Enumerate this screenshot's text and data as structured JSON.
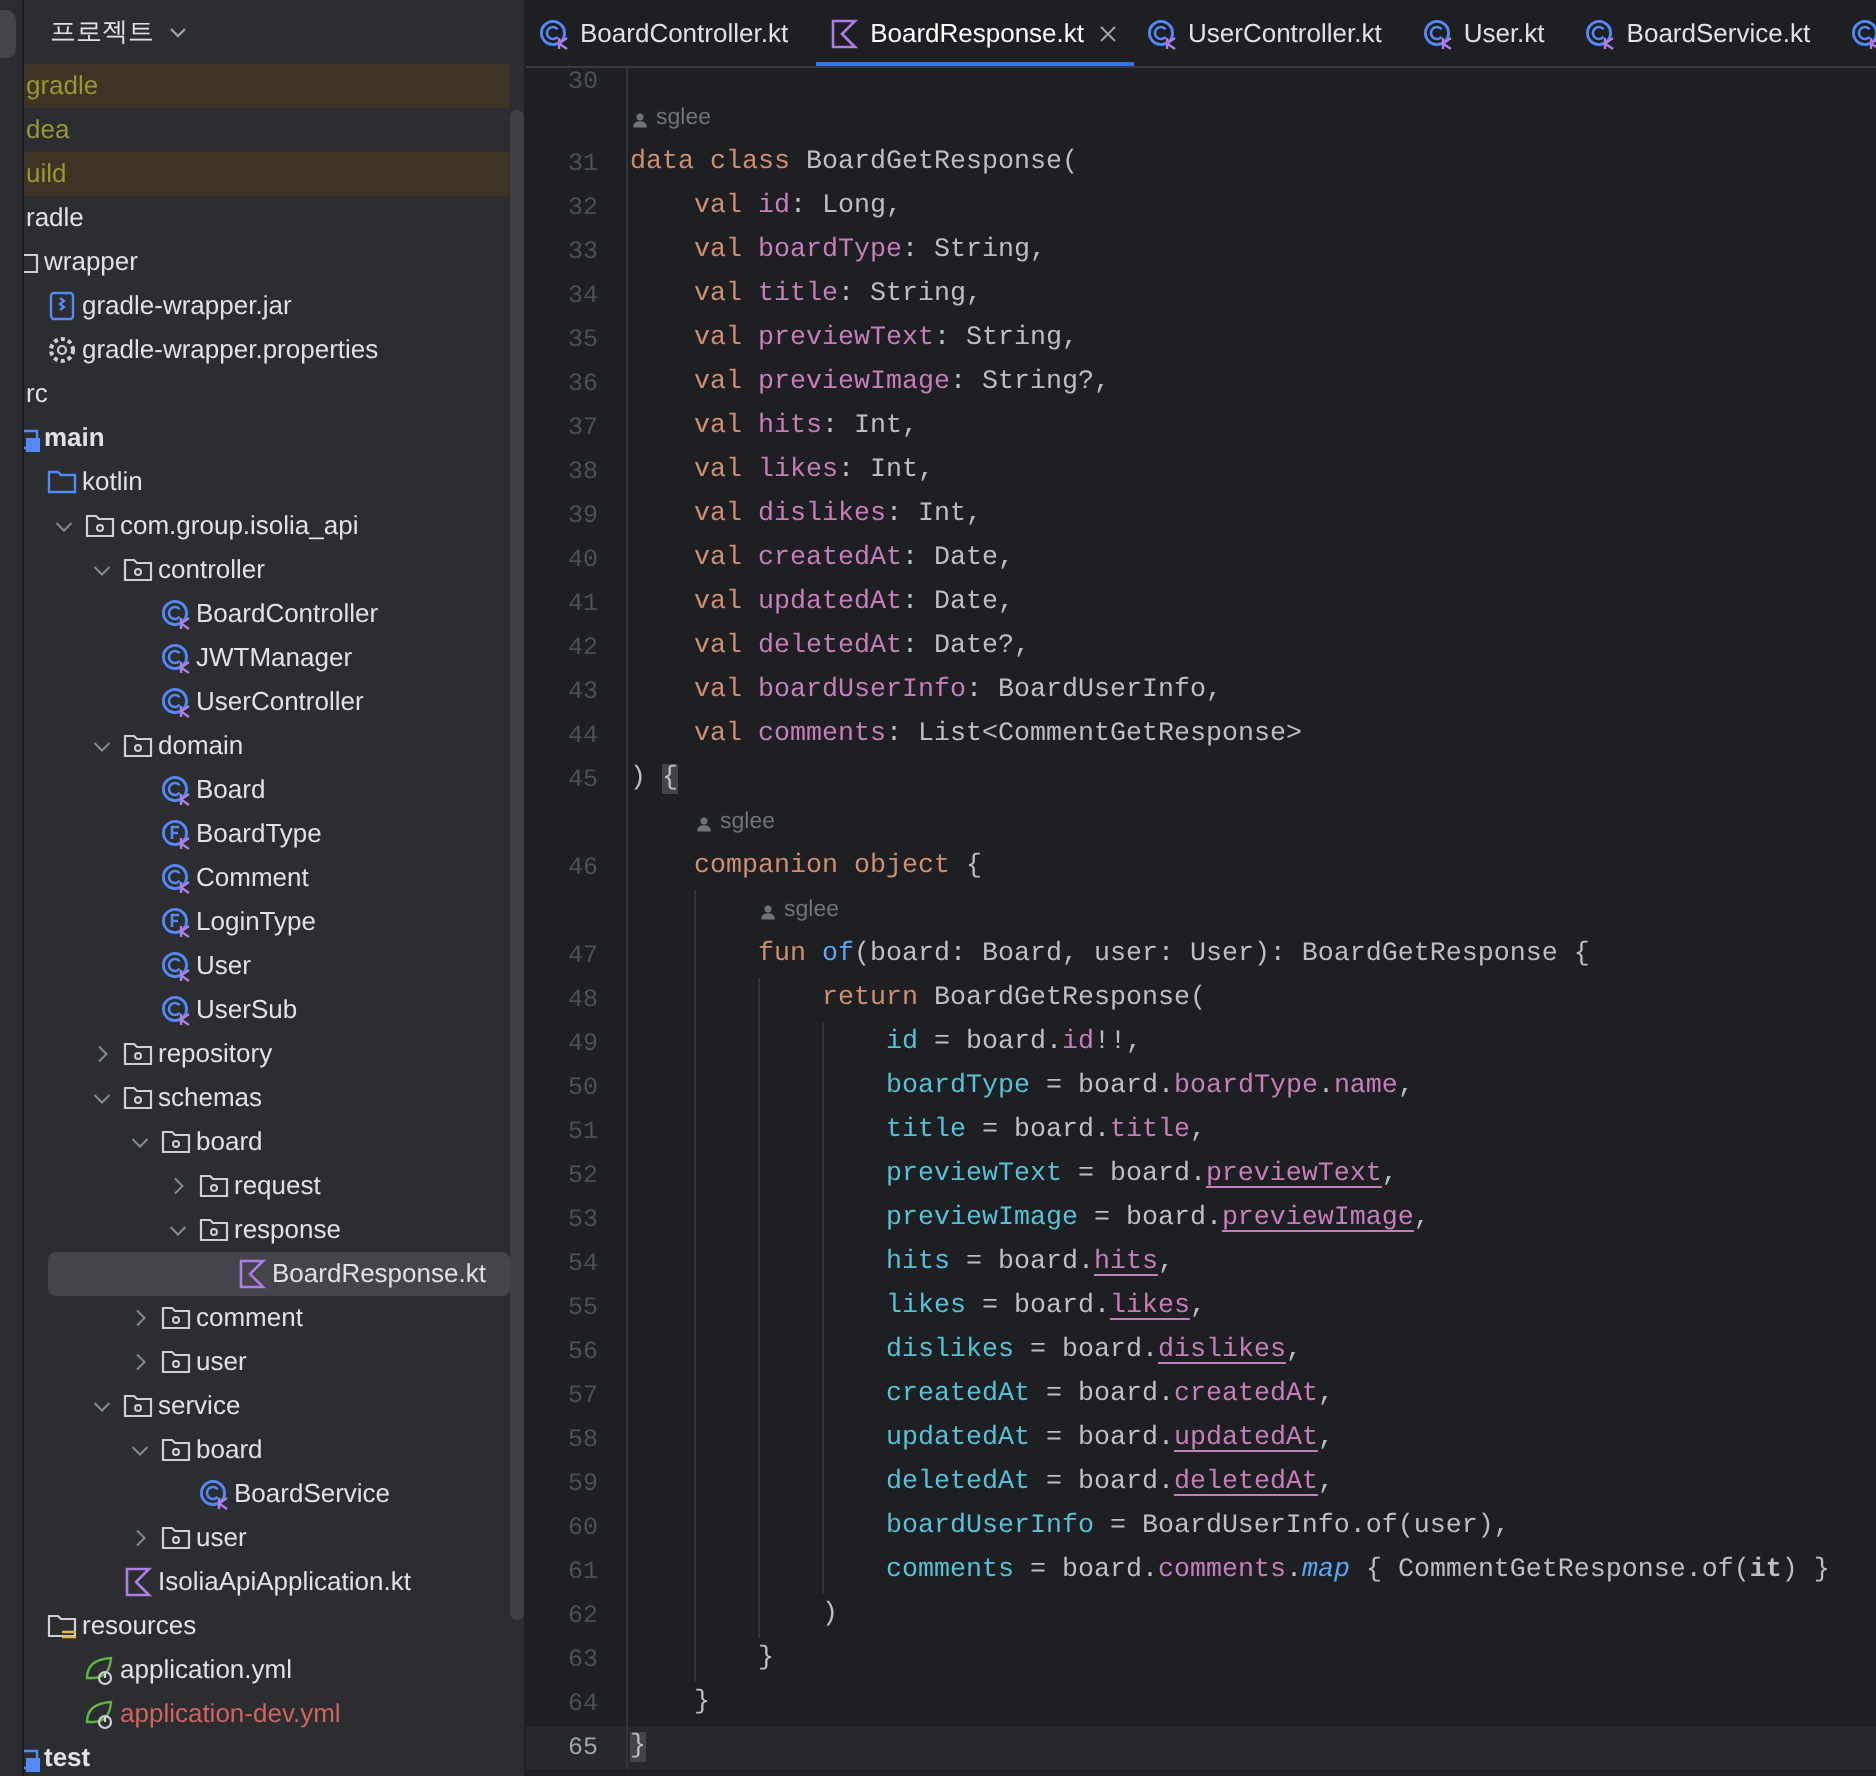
{
  "project_panel": {
    "title": "프로젝트",
    "tree": [
      {
        "label": "gradle",
        "ignored": true,
        "excluded": true,
        "unversioned": false,
        "selected": false
      },
      {
        "label": "dea",
        "ignored": true,
        "excluded": false,
        "unversioned": false,
        "selected": false
      },
      {
        "label": "uild",
        "ignored": true,
        "excluded": true,
        "unversioned": false,
        "selected": false
      },
      {
        "label": "radle",
        "ignored": false,
        "excluded": false,
        "unversioned": false,
        "selected": false,
        "children": [
          {
            "label": "wrapper",
            "kind": "folder",
            "ignored": false,
            "excluded": false,
            "unversioned": false,
            "selected": false,
            "children": [
              {
                "label": "gradle-wrapper.jar",
                "kind": "jar",
                "ignored": false,
                "excluded": false,
                "unversioned": false,
                "selected": false
              },
              {
                "label": "gradle-wrapper.properties",
                "kind": "properties",
                "ignored": false,
                "excluded": false,
                "unversioned": false,
                "selected": false
              }
            ]
          }
        ]
      },
      {
        "label": "rc",
        "ignored": false,
        "excluded": false,
        "unversioned": false,
        "selected": false,
        "children": [
          {
            "label": "main",
            "kind": "module",
            "ignored": false,
            "excluded": false,
            "unversioned": false,
            "selected": false,
            "children": [
              {
                "label": "kotlin",
                "kind": "source_folder",
                "ignored": false,
                "excluded": false,
                "unversioned": false,
                "selected": false,
                "children": [
                  {
                    "label": "com.group.isolia_api",
                    "kind": "package",
                    "ignored": false,
                    "excluded": false,
                    "unversioned": false,
                    "selected": false,
                    "expanded": true,
                    "children": [
                      {
                        "label": "controller",
                        "kind": "package",
                        "ignored": false,
                        "excluded": false,
                        "unversioned": false,
                        "selected": false,
                        "expanded": true,
                        "children": [
                          {
                            "label": "BoardController",
                            "kind": "class",
                            "ignored": false,
                            "excluded": false,
                            "unversioned": false,
                            "selected": false
                          },
                          {
                            "label": "JWTManager",
                            "kind": "class",
                            "ignored": false,
                            "excluded": false,
                            "unversioned": false,
                            "selected": false
                          },
                          {
                            "label": "UserController",
                            "kind": "class",
                            "ignored": false,
                            "excluded": false,
                            "unversioned": false,
                            "selected": false
                          }
                        ]
                      },
                      {
                        "label": "domain",
                        "kind": "package",
                        "ignored": false,
                        "excluded": false,
                        "unversioned": false,
                        "selected": false,
                        "expanded": true,
                        "children": [
                          {
                            "label": "Board",
                            "kind": "class",
                            "ignored": false,
                            "excluded": false,
                            "unversioned": false,
                            "selected": false
                          },
                          {
                            "label": "BoardType",
                            "kind": "enum",
                            "ignored": false,
                            "excluded": false,
                            "unversioned": false,
                            "selected": false
                          },
                          {
                            "label": "Comment",
                            "kind": "class",
                            "ignored": false,
                            "excluded": false,
                            "unversioned": false,
                            "selected": false
                          },
                          {
                            "label": "LoginType",
                            "kind": "enum",
                            "ignored": false,
                            "excluded": false,
                            "unversioned": false,
                            "selected": false
                          },
                          {
                            "label": "User",
                            "kind": "class",
                            "ignored": false,
                            "excluded": false,
                            "unversioned": false,
                            "selected": false
                          },
                          {
                            "label": "UserSub",
                            "kind": "class",
                            "ignored": false,
                            "excluded": false,
                            "unversioned": false,
                            "selected": false
                          }
                        ]
                      },
                      {
                        "label": "repository",
                        "kind": "package",
                        "ignored": false,
                        "excluded": false,
                        "unversioned": false,
                        "selected": false,
                        "expanded": false
                      },
                      {
                        "label": "schemas",
                        "kind": "package",
                        "ignored": false,
                        "excluded": false,
                        "unversioned": false,
                        "selected": false,
                        "expanded": true,
                        "children": [
                          {
                            "label": "board",
                            "kind": "package",
                            "ignored": false,
                            "excluded": false,
                            "unversioned": false,
                            "selected": false,
                            "expanded": true,
                            "children": [
                              {
                                "label": "request",
                                "kind": "package",
                                "ignored": false,
                                "excluded": false,
                                "unversioned": false,
                                "selected": false,
                                "expanded": false
                              },
                              {
                                "label": "response",
                                "kind": "package",
                                "ignored": false,
                                "excluded": false,
                                "unversioned": false,
                                "selected": false,
                                "expanded": true,
                                "children": [
                                  {
                                    "label": "BoardResponse.kt",
                                    "kind": "kotlin_file",
                                    "ignored": false,
                                    "excluded": false,
                                    "unversioned": false,
                                    "selected": true
                                  }
                                ]
                              }
                            ]
                          },
                          {
                            "label": "comment",
                            "kind": "package",
                            "ignored": false,
                            "excluded": false,
                            "unversioned": false,
                            "selected": false,
                            "expanded": false
                          },
                          {
                            "label": "user",
                            "kind": "package",
                            "ignored": false,
                            "excluded": false,
                            "unversioned": false,
                            "selected": false,
                            "expanded": false
                          }
                        ]
                      },
                      {
                        "label": "service",
                        "kind": "package",
                        "ignored": false,
                        "excluded": false,
                        "unversioned": false,
                        "selected": false,
                        "expanded": true,
                        "children": [
                          {
                            "label": "board",
                            "kind": "package",
                            "ignored": false,
                            "excluded": false,
                            "unversioned": false,
                            "selected": false,
                            "expanded": true,
                            "children": [
                              {
                                "label": "BoardService",
                                "kind": "class",
                                "ignored": false,
                                "excluded": false,
                                "unversioned": false,
                                "selected": false
                              }
                            ]
                          },
                          {
                            "label": "user",
                            "kind": "package",
                            "ignored": false,
                            "excluded": false,
                            "unversioned": false,
                            "selected": false,
                            "expanded": false
                          }
                        ]
                      },
                      {
                        "label": "IsoliaApiApplication.kt",
                        "kind": "kotlin_file",
                        "ignored": false,
                        "excluded": false,
                        "unversioned": false,
                        "selected": false
                      }
                    ]
                  }
                ]
              },
              {
                "label": "resources",
                "kind": "resources_folder",
                "ignored": false,
                "excluded": false,
                "unversioned": false,
                "selected": false,
                "children": [
                  {
                    "label": "application.yml",
                    "kind": "spring_config",
                    "ignored": false,
                    "excluded": false,
                    "unversioned": false,
                    "selected": false
                  },
                  {
                    "label": "application-dev.yml",
                    "kind": "spring_config",
                    "ignored": false,
                    "excluded": false,
                    "unversioned": true,
                    "selected": false
                  }
                ]
              }
            ]
          },
          {
            "label": "test",
            "kind": "module",
            "ignored": false,
            "excluded": false,
            "unversioned": false,
            "selected": false
          }
        ]
      }
    ]
  },
  "editor": {
    "tabs": [
      {
        "label": "BoardController.kt",
        "kind": "class",
        "selected": false
      },
      {
        "label": "BoardResponse.kt",
        "kind": "kotlin_file",
        "selected": true
      },
      {
        "label": "UserController.kt",
        "kind": "class",
        "selected": false
      },
      {
        "label": "User.kt",
        "kind": "class",
        "selected": false
      },
      {
        "label": "BoardService.kt",
        "kind": "class",
        "selected": false
      },
      {
        "kind": "class",
        "selected": false
      }
    ],
    "lines": [
      {
        "kind": "code",
        "number": "30",
        "current": false
      },
      {
        "kind": "hint",
        "author": "sglee"
      },
      {
        "kind": "code",
        "number": "31",
        "current": false,
        "tokens": [
          {
            "text": "data",
            "kind": "kw"
          },
          {
            "text": " class",
            "kind": "kw"
          },
          {
            "text": " BoardGetResponse(",
            "kind": "plain"
          }
        ]
      },
      {
        "kind": "code",
        "number": "32",
        "current": false,
        "tokens": [
          {
            "text": "    val",
            "kind": "kw"
          },
          {
            "text": " id",
            "kind": "prop"
          },
          {
            "text": ": Long,",
            "kind": "plain"
          }
        ]
      },
      {
        "kind": "code",
        "number": "33",
        "current": false,
        "tokens": [
          {
            "text": "    val",
            "kind": "kw"
          },
          {
            "text": " boardType",
            "kind": "prop"
          },
          {
            "text": ": String,",
            "kind": "plain"
          }
        ]
      },
      {
        "kind": "code",
        "number": "34",
        "current": false,
        "tokens": [
          {
            "text": "    val",
            "kind": "kw"
          },
          {
            "text": " title",
            "kind": "prop"
          },
          {
            "text": ": String,",
            "kind": "plain"
          }
        ]
      },
      {
        "kind": "code",
        "number": "35",
        "current": false,
        "tokens": [
          {
            "text": "    val",
            "kind": "kw"
          },
          {
            "text": " previewText",
            "kind": "prop"
          },
          {
            "text": ": String,",
            "kind": "plain"
          }
        ]
      },
      {
        "kind": "code",
        "number": "36",
        "current": false,
        "tokens": [
          {
            "text": "    val",
            "kind": "kw"
          },
          {
            "text": " previewImage",
            "kind": "prop"
          },
          {
            "text": ": String?,",
            "kind": "plain"
          }
        ]
      },
      {
        "kind": "code",
        "number": "37",
        "current": false,
        "tokens": [
          {
            "text": "    val",
            "kind": "kw"
          },
          {
            "text": " hits",
            "kind": "prop"
          },
          {
            "text": ": Int,",
            "kind": "plain"
          }
        ]
      },
      {
        "kind": "code",
        "number": "38",
        "current": false,
        "tokens": [
          {
            "text": "    val",
            "kind": "kw"
          },
          {
            "text": " likes",
            "kind": "prop"
          },
          {
            "text": ": Int,",
            "kind": "plain"
          }
        ]
      },
      {
        "kind": "code",
        "number": "39",
        "current": false,
        "tokens": [
          {
            "text": "    val",
            "kind": "kw"
          },
          {
            "text": " dislikes",
            "kind": "prop"
          },
          {
            "text": ": Int,",
            "kind": "plain"
          }
        ]
      },
      {
        "kind": "code",
        "number": "40",
        "current": false,
        "tokens": [
          {
            "text": "    val",
            "kind": "kw"
          },
          {
            "text": " createdAt",
            "kind": "prop"
          },
          {
            "text": ": Date,",
            "kind": "plain"
          }
        ]
      },
      {
        "kind": "code",
        "number": "41",
        "current": false,
        "tokens": [
          {
            "text": "    val",
            "kind": "kw"
          },
          {
            "text": " updatedAt",
            "kind": "prop"
          },
          {
            "text": ": Date,",
            "kind": "plain"
          }
        ]
      },
      {
        "kind": "code",
        "number": "42",
        "current": false,
        "tokens": [
          {
            "text": "    val",
            "kind": "kw"
          },
          {
            "text": " deletedAt",
            "kind": "prop"
          },
          {
            "text": ": Date?,",
            "kind": "plain"
          }
        ]
      },
      {
        "kind": "code",
        "number": "43",
        "current": false,
        "tokens": [
          {
            "text": "    val",
            "kind": "kw"
          },
          {
            "text": " boardUserInfo",
            "kind": "prop"
          },
          {
            "text": ": BoardUserInfo,",
            "kind": "plain"
          }
        ]
      },
      {
        "kind": "code",
        "number": "44",
        "current": false,
        "tokens": [
          {
            "text": "    val",
            "kind": "kw"
          },
          {
            "text": " comments",
            "kind": "prop"
          },
          {
            "text": ": List<CommentGetResponse>",
            "kind": "plain"
          }
        ]
      },
      {
        "kind": "code",
        "number": "45",
        "current": false,
        "tokens": [
          {
            "text": ")",
            "kind": "plain"
          },
          {
            "kind": "gap"
          },
          {
            "text": "{",
            "kind": "brace_match"
          }
        ]
      },
      {
        "kind": "hint",
        "author": "sglee"
      },
      {
        "kind": "code",
        "number": "46",
        "current": false,
        "tokens": [
          {
            "text": "    companion",
            "kind": "kw"
          },
          {
            "text": " object",
            "kind": "kw"
          },
          {
            "text": " {",
            "kind": "plain"
          }
        ]
      },
      {
        "kind": "hint",
        "author": "sglee"
      },
      {
        "kind": "code",
        "number": "47",
        "current": false,
        "tokens": [
          {
            "text": "        fun",
            "kind": "kw"
          },
          {
            "text": " of",
            "kind": "fn"
          },
          {
            "text": "(board: Board, user: User): BoardGetResponse {",
            "kind": "plain"
          }
        ]
      },
      {
        "kind": "code",
        "number": "48",
        "current": false,
        "tokens": [
          {
            "text": "            return",
            "kind": "kw"
          },
          {
            "text": " BoardGetResponse(",
            "kind": "plain"
          }
        ]
      },
      {
        "kind": "code",
        "number": "49",
        "current": false,
        "tokens": [
          {
            "text": "                id",
            "kind": "arg"
          },
          {
            "text": " = board.",
            "kind": "plain"
          },
          {
            "text": "id",
            "kind": "prop"
          },
          {
            "text": "!!,",
            "kind": "plain"
          }
        ]
      },
      {
        "kind": "code",
        "number": "50",
        "current": false,
        "tokens": [
          {
            "text": "                boardType",
            "kind": "arg"
          },
          {
            "text": " = board.",
            "kind": "plain"
          },
          {
            "text": "boardType",
            "kind": "prop"
          },
          {
            "text": ".",
            "kind": "plain"
          },
          {
            "text": "name",
            "kind": "prop"
          },
          {
            "text": ",",
            "kind": "plain"
          }
        ]
      },
      {
        "kind": "code",
        "number": "51",
        "current": false,
        "tokens": [
          {
            "text": "                title",
            "kind": "arg"
          },
          {
            "text": " = board.",
            "kind": "plain"
          },
          {
            "text": "title",
            "kind": "prop"
          },
          {
            "text": ",",
            "kind": "plain"
          }
        ]
      },
      {
        "kind": "code",
        "number": "52",
        "current": false,
        "tokens": [
          {
            "text": "                previewText",
            "kind": "arg"
          },
          {
            "text": " = board.",
            "kind": "plain"
          },
          {
            "text": "previewText",
            "kind": "prop_mutable"
          },
          {
            "text": ",",
            "kind": "plain"
          }
        ]
      },
      {
        "kind": "code",
        "number": "53",
        "current": false,
        "tokens": [
          {
            "text": "                previewImage",
            "kind": "arg"
          },
          {
            "text": " = board.",
            "kind": "plain"
          },
          {
            "text": "previewImage",
            "kind": "prop_mutable"
          },
          {
            "text": ",",
            "kind": "plain"
          }
        ]
      },
      {
        "kind": "code",
        "number": "54",
        "current": false,
        "tokens": [
          {
            "text": "                hits",
            "kind": "arg"
          },
          {
            "text": " = board.",
            "kind": "plain"
          },
          {
            "text": "hits",
            "kind": "prop_mutable"
          },
          {
            "text": ",",
            "kind": "plain"
          }
        ]
      },
      {
        "kind": "code",
        "number": "55",
        "current": false,
        "tokens": [
          {
            "text": "                likes",
            "kind": "arg"
          },
          {
            "text": " = board.",
            "kind": "plain"
          },
          {
            "text": "likes",
            "kind": "prop_mutable"
          },
          {
            "text": ",",
            "kind": "plain"
          }
        ]
      },
      {
        "kind": "code",
        "number": "56",
        "current": false,
        "tokens": [
          {
            "text": "                dislikes",
            "kind": "arg"
          },
          {
            "text": " = board.",
            "kind": "plain"
          },
          {
            "text": "dislikes",
            "kind": "prop_mutable"
          },
          {
            "text": ",",
            "kind": "plain"
          }
        ]
      },
      {
        "kind": "code",
        "number": "57",
        "current": false,
        "tokens": [
          {
            "text": "                createdAt",
            "kind": "arg"
          },
          {
            "text": " = board.",
            "kind": "plain"
          },
          {
            "text": "createdAt",
            "kind": "prop"
          },
          {
            "text": ",",
            "kind": "plain"
          }
        ]
      },
      {
        "kind": "code",
        "number": "58",
        "current": false,
        "tokens": [
          {
            "text": "                updatedAt",
            "kind": "arg"
          },
          {
            "text": " = board.",
            "kind": "plain"
          },
          {
            "text": "updatedAt",
            "kind": "prop_mutable"
          },
          {
            "text": ",",
            "kind": "plain"
          }
        ]
      },
      {
        "kind": "code",
        "number": "59",
        "current": false,
        "tokens": [
          {
            "text": "                deletedAt",
            "kind": "arg"
          },
          {
            "text": " = board.",
            "kind": "plain"
          },
          {
            "text": "deletedAt",
            "kind": "prop_mutable"
          },
          {
            "text": ",",
            "kind": "plain"
          }
        ]
      },
      {
        "kind": "code",
        "number": "60",
        "current": false,
        "tokens": [
          {
            "text": "                boardUserInfo",
            "kind": "arg"
          },
          {
            "text": " = BoardUserInfo.of(user),",
            "kind": "plain"
          }
        ]
      },
      {
        "kind": "code",
        "number": "61",
        "current": false,
        "tokens": [
          {
            "text": "                comments",
            "kind": "arg"
          },
          {
            "text": " = board.",
            "kind": "plain"
          },
          {
            "text": "comments",
            "kind": "prop"
          },
          {
            "text": ".",
            "kind": "plain"
          },
          {
            "text": "map",
            "kind": "fn_call_ext"
          },
          {
            "text": " { CommentGetResponse.of(",
            "kind": "plain"
          },
          {
            "text": "it",
            "kind": "bold"
          },
          {
            "text": ") }",
            "kind": "plain"
          }
        ]
      },
      {
        "kind": "code",
        "number": "62",
        "current": false,
        "tokens": [
          {
            "text": "            )",
            "kind": "plain"
          }
        ]
      },
      {
        "kind": "code",
        "number": "63",
        "current": false,
        "tokens": [
          {
            "text": "        }",
            "kind": "plain"
          }
        ]
      },
      {
        "kind": "code",
        "number": "64",
        "current": false,
        "tokens": [
          {
            "text": "    }",
            "kind": "plain"
          }
        ]
      },
      {
        "kind": "code",
        "number": "65",
        "current": true,
        "tokens": [
          {
            "text": "}",
            "kind": "brace_match"
          }
        ]
      }
    ]
  }
}
